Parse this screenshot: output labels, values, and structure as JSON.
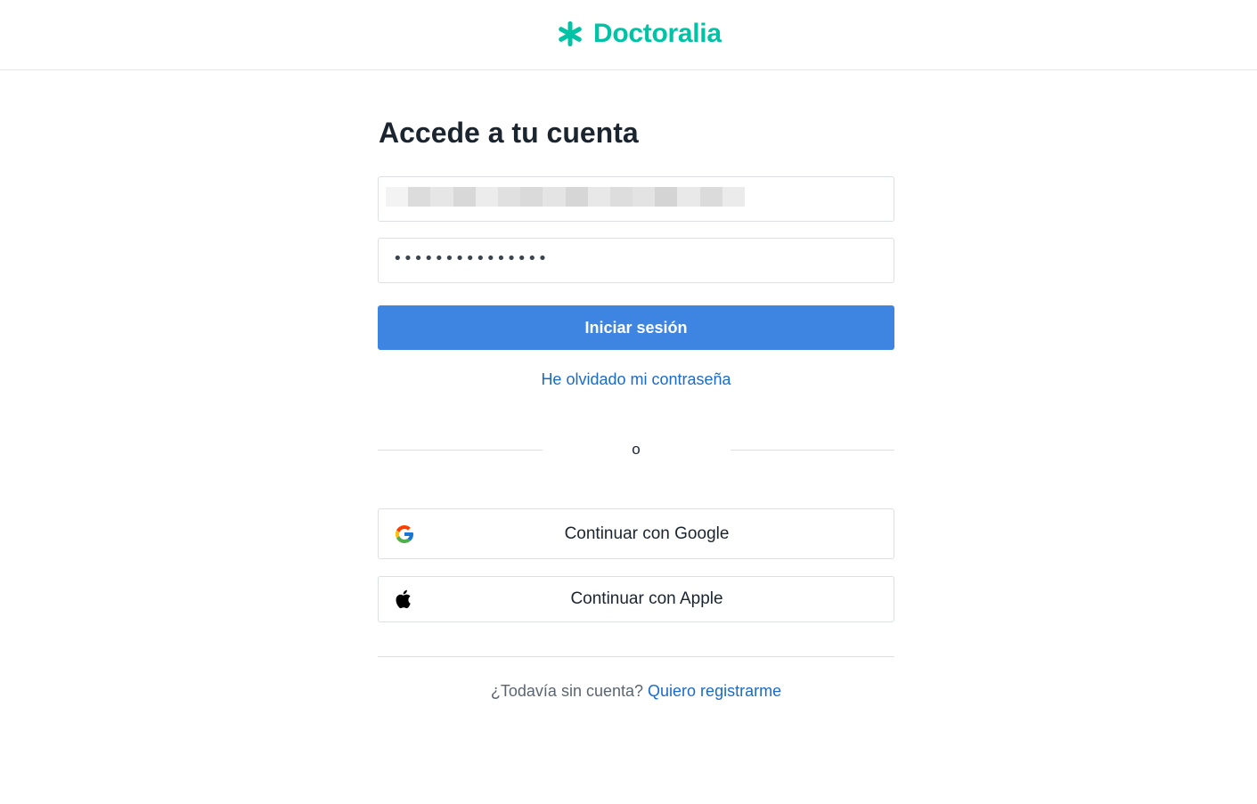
{
  "header": {
    "logo_text": "Doctoralia",
    "brand_color": "#00c3a5"
  },
  "login": {
    "title": "Accede a tu cuenta",
    "email_value_redacted": true,
    "password_value": "•••••••••••••••",
    "submit_label": "Iniciar sesión",
    "submit_color": "#3d85e0",
    "forgot_label": "He olvidado mi contraseña"
  },
  "divider": {
    "label": "o"
  },
  "social": {
    "google_label": "Continuar con Google",
    "google_icon": "google-g-icon",
    "apple_label": "Continuar con Apple",
    "apple_icon": "apple-icon"
  },
  "footer": {
    "prompt": "¿Todavía sin cuenta?",
    "register_label": "Quiero registrarme",
    "link_color": "#1a6bc8"
  }
}
